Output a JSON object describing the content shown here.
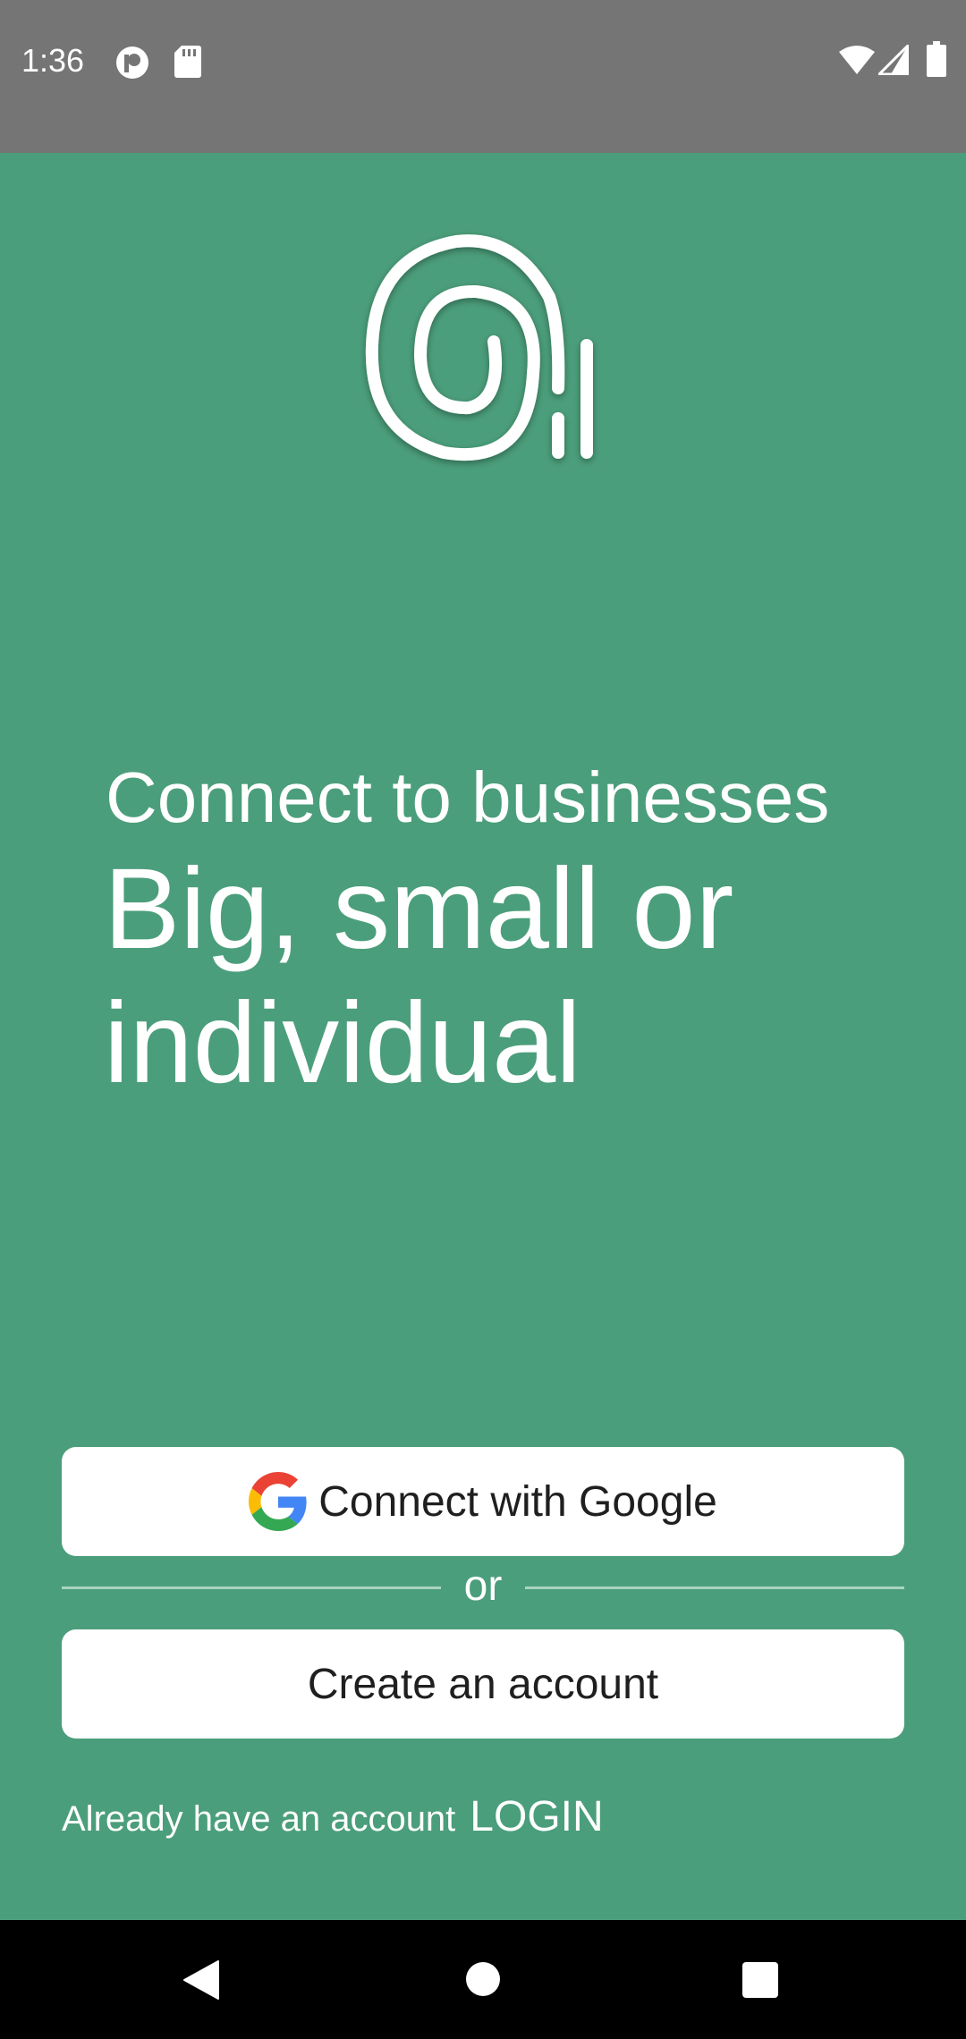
{
  "status_bar": {
    "time": "1:36",
    "left_icons": [
      "pocket-casts-icon",
      "sd-card-icon"
    ],
    "right_icons": [
      "wifi-icon",
      "cell-signal-icon",
      "battery-icon"
    ]
  },
  "brand": {
    "logo_icon": "fingerprint-icon",
    "background_color": "#4b9e7b"
  },
  "hero": {
    "tagline": "Connect to businesses",
    "headline": "Big, small or individual"
  },
  "actions": {
    "google_button_label": "Connect with Google",
    "google_icon": "google-g-icon",
    "divider_label": "or",
    "create_account_label": "Create an account"
  },
  "login": {
    "prompt": "Already have an account",
    "link_label": "LOGIN"
  },
  "nav_bar": {
    "buttons": [
      "back-icon",
      "home-icon",
      "recents-icon"
    ]
  }
}
